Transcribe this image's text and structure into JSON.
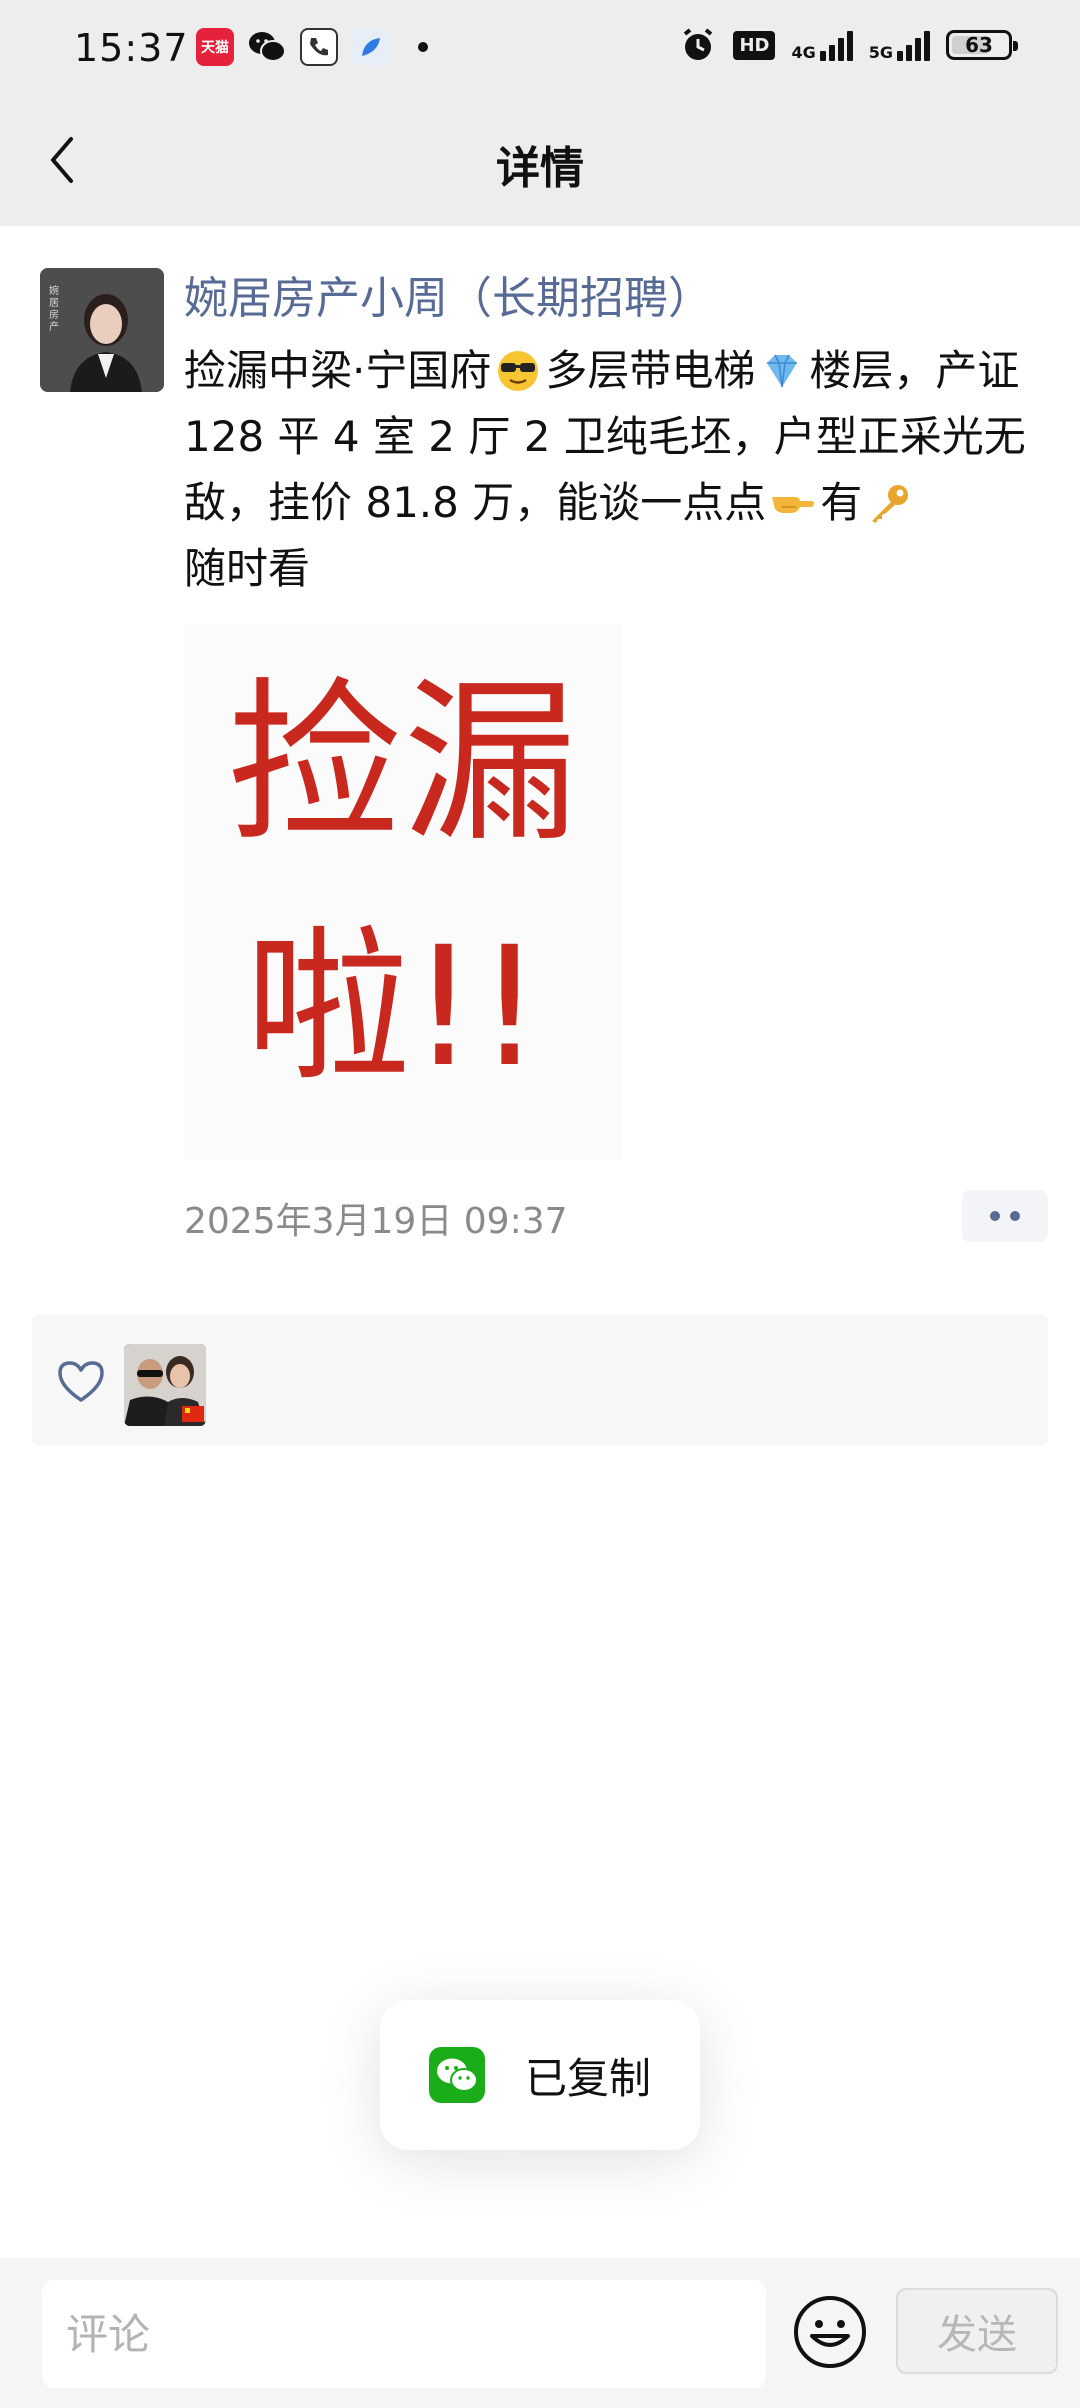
{
  "status_bar": {
    "time": "15:37",
    "app_icons": [
      {
        "name": "tmall-icon",
        "label": "天猫",
        "color": "#e6213c"
      },
      {
        "name": "wechat-icon",
        "label": "",
        "color": "#111111"
      },
      {
        "name": "hotline-app-icon",
        "label": "",
        "color": "#333333"
      },
      {
        "name": "feather-app-icon",
        "label": "",
        "color": "#2f7be3"
      }
    ],
    "hd_label": "HD",
    "net_4g": "4G",
    "net_5g": "5G",
    "battery_level": "63"
  },
  "nav": {
    "title": "详情"
  },
  "post": {
    "author": "婉居房产小周（长期招聘）",
    "avatar_caption": "婉居房产",
    "text_segments": {
      "p1": "捡漏中梁·宁国府",
      "p2": "多层带电梯",
      "p3": "楼层，产证 128 平 4 室 2 厅 2 卫纯毛坯，户型正采光无敌，挂价 81.8 万，能谈一点点",
      "p4": "有",
      "p5": "随时看"
    },
    "image_text_line1": "捡漏",
    "image_text_line2": "啦!!",
    "timestamp": "2025年3月19日 09:37"
  },
  "toast": {
    "text": "已复制"
  },
  "bottom": {
    "comment_placeholder": "评论",
    "send_label": "发送"
  },
  "colors": {
    "author": "#576b95",
    "image_text": "#c8281e",
    "wechat_green": "#1aad19"
  }
}
